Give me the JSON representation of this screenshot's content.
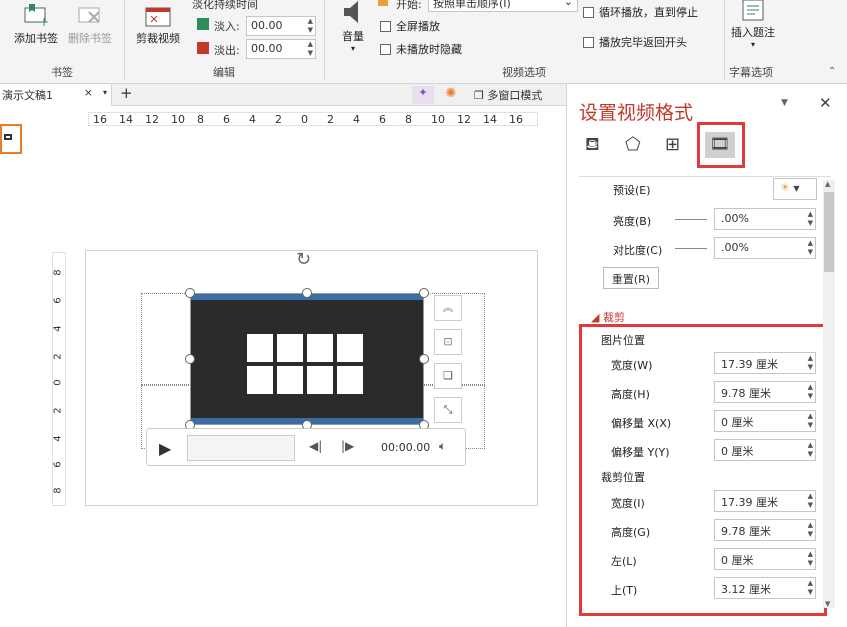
{
  "ribbon": {
    "add_bookmark": "添加书签",
    "remove_bookmark": "删除书签",
    "bookmark_group": "书签",
    "trim_video": "剪裁视频",
    "fade_duration": "淡化持续时间",
    "fade_in_label": "淡入:",
    "fade_in_value": "00.00",
    "fade_out_label": "淡出:",
    "fade_out_value": "00.00",
    "edit_group": "编辑",
    "volume": "音量",
    "start_label": "开始:",
    "start_value": "按照单击顺序(I)",
    "fullscreen": "全屏播放",
    "hide_not_playing": "未播放时隐藏",
    "loop": "循环播放，直到停止",
    "rewind": "播放完毕返回开头",
    "video_options_group": "视频选项",
    "insert_caption": "插入题注",
    "caption_group": "字幕选项"
  },
  "tabs": {
    "doc_tab": "演示文稿1",
    "close": "×",
    "add": "+",
    "multi_window": "多窗口模式"
  },
  "ruler": {
    "h_ticks": [
      "16",
      "14",
      "12",
      "10",
      "8",
      "6",
      "4",
      "2",
      "0",
      "2",
      "4",
      "6",
      "8",
      "10",
      "12",
      "14",
      "16"
    ],
    "v_ticks": [
      "8",
      "6",
      "4",
      "2",
      "0",
      "2",
      "4",
      "6",
      "8"
    ]
  },
  "player": {
    "time": "00:00.00"
  },
  "pane": {
    "title": "设置视频格式",
    "preset_label": "预设(E)",
    "brightness_label": "亮度(B)",
    "brightness_value": ".00%",
    "contrast_label": "对比度(C)",
    "contrast_value": ".00%",
    "reset_label": "重置(R)",
    "crop_section": "裁剪",
    "image_position": "图片位置",
    "width_label": "宽度(W)",
    "width_value": "17.39 厘米",
    "height_label": "高度(H)",
    "height_value": "9.78 厘米",
    "offset_x_label": "偏移量 X(X)",
    "offset_x_value": "0 厘米",
    "offset_y_label": "偏移量 Y(Y)",
    "offset_y_value": "0 厘米",
    "crop_position": "裁剪位置",
    "crop_width_label": "宽度(I)",
    "crop_width_value": "17.39 厘米",
    "crop_height_label": "高度(G)",
    "crop_height_value": "9.78 厘米",
    "left_label": "左(L)",
    "left_value": "0 厘米",
    "top_label": "上(T)",
    "top_value": "3.12 厘米"
  }
}
